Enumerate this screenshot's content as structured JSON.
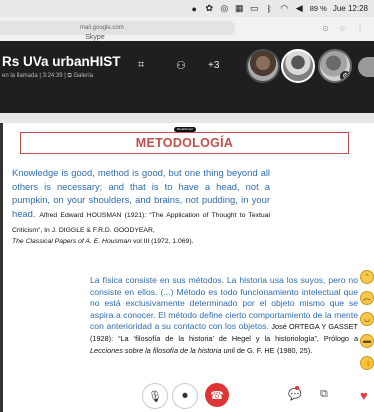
{
  "menubar": {
    "icons": [
      "record-icon",
      "extension-icon",
      "screen-icon",
      "display-icon",
      "cast-icon",
      "bluetooth-icon",
      "wifi-icon",
      "volume-icon"
    ],
    "battery": "89 %",
    "clock": "Jue 12:28"
  },
  "browser": {
    "url": "mail.google.com",
    "window_title": "Skype"
  },
  "call": {
    "title": "Rs UVa urbanHIST",
    "subtitle": "en la llamada | 3:24:39 | ⧉ Galería",
    "participants_more": "+3"
  },
  "slide": {
    "badge": "MediaSmart",
    "title": "METODOLOGÍA",
    "quote1": "Knowledge is good, method is good, but one thing beyond all others is necessary; and that is to have a head, not a pumpkin, on your shoulders, and brains, not pudding, in your head.",
    "quote1_ref_a": "Alfred Edward HOUSMAN (1921): “The Application of Thought to Textual Criticism”, In J. DIGGLE & F.R.D. GOODYEAR,",
    "quote1_ref_b": "The Classical Papers of A. E. Housman",
    "quote1_ref_c": "vol III (1972, 1.069).",
    "quote2": "La física consiste en sus métodos. La historia usa los suyos, pero no consiste en ellos. (...) Método es todo funcionamiento intelectual que no está exclusivamente determinado por el objeto mismo que se aspira a conocer. El método define cierto comportamiento de la mente con anterioridad a su contacto con los objetos.",
    "quote2_ref_a": "José ORTEGA Y GASSET (1928): “La ‘filosofía de la historia’ de Hegel y la historiología”, Prólogo a",
    "quote2_ref_b": "Lecciones sobre la filosofía de la historia uni",
    "quote2_ref_c": "l de G. F. HE",
    "quote2_ref_d": "(1980, 25)."
  },
  "reactions": [
    "laughing-emoji",
    "frowning-emoji",
    "smiling-emoji",
    "sunglasses-emoji",
    "thumbs-up-emoji",
    "heart-icon"
  ],
  "controls": {
    "mic": "🎙",
    "camera": "⏺",
    "hangup": "☎",
    "chat": "💬",
    "share": "⧉"
  },
  "colors": {
    "accent_title": "#c0504d",
    "quote_text": "#2f6db0",
    "hangup": "#e03535"
  }
}
